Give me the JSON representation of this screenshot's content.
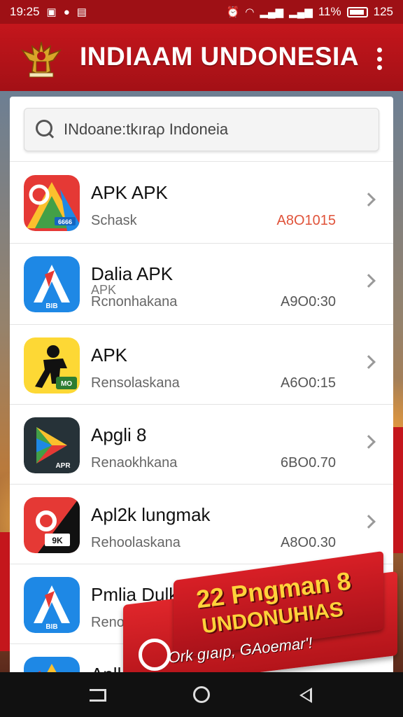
{
  "status_bar": {
    "time": "19:25",
    "battery_percent": "11%",
    "right_number": "125",
    "icons": [
      "carrier-icon",
      "circle-notification-icon",
      "photo-icon",
      "alarm-icon",
      "wifi-icon",
      "signal-icon",
      "signal-icon",
      "battery-icon"
    ]
  },
  "app_bar": {
    "title": "ΙΝDIAAM UNDONESIA",
    "logo_icon": "garuda-emblem-icon",
    "menu_icon": "more-vert-icon"
  },
  "search": {
    "text": "INdoane:tkıraρ Indoneia"
  },
  "apps": [
    {
      "name": "APK APK",
      "subtitle": "",
      "developer": "Schask",
      "meta": "A8O1015",
      "meta_color": "#e0533a",
      "icon": "maps-style-app-icon",
      "badge": "6666"
    },
    {
      "name": "Dalia APK",
      "subtitle": "APK",
      "developer": "Rcnonhakana",
      "meta": "A9O0:30",
      "meta_color": "#555555",
      "icon": "blue-letter-a-app-icon",
      "badge": "BIB"
    },
    {
      "name": "APK",
      "subtitle": "",
      "developer": "Rensolaskana",
      "meta": "A6O0:15",
      "meta_color": "#555555",
      "icon": "yellow-silhouette-app-icon",
      "badge": "MO"
    },
    {
      "name": "Apgli 8",
      "subtitle": "",
      "developer": "Renaokhkana",
      "meta": "6BO0.70",
      "meta_color": "#555555",
      "icon": "play-store-style-app-icon",
      "badge": "APR"
    },
    {
      "name": "Apl2k lungmak",
      "subtitle": "",
      "developer": "Rehoolaskana",
      "meta": "A8O0.30",
      "meta_color": "#555555",
      "icon": "red-black-app-icon",
      "badge": "9K"
    },
    {
      "name": "Pmlia Dulk",
      "subtitle": "",
      "developer": "Renoel",
      "meta": "",
      "meta_color": "#555555",
      "icon": "blue-letter-a-app-icon",
      "badge": "BIB"
    },
    {
      "name": "Aplk",
      "subtitle": "",
      "developer": "",
      "meta": "",
      "meta_color": "#555555",
      "icon": "maps-style-app-icon",
      "badge": ""
    }
  ],
  "promo": {
    "title": "22 Pngman 8",
    "subtitle": "UNDONUHIAS",
    "tagline": "Ork ɡıaıp, GAoemar'!"
  },
  "nav_bar": {
    "buttons": [
      "recent-apps-icon",
      "home-icon",
      "back-icon"
    ]
  },
  "colors": {
    "brand_red": "#c4161c",
    "status_red": "#9e1015",
    "promo_yellow": "#ffd23a",
    "meta_red": "#e0533a"
  }
}
